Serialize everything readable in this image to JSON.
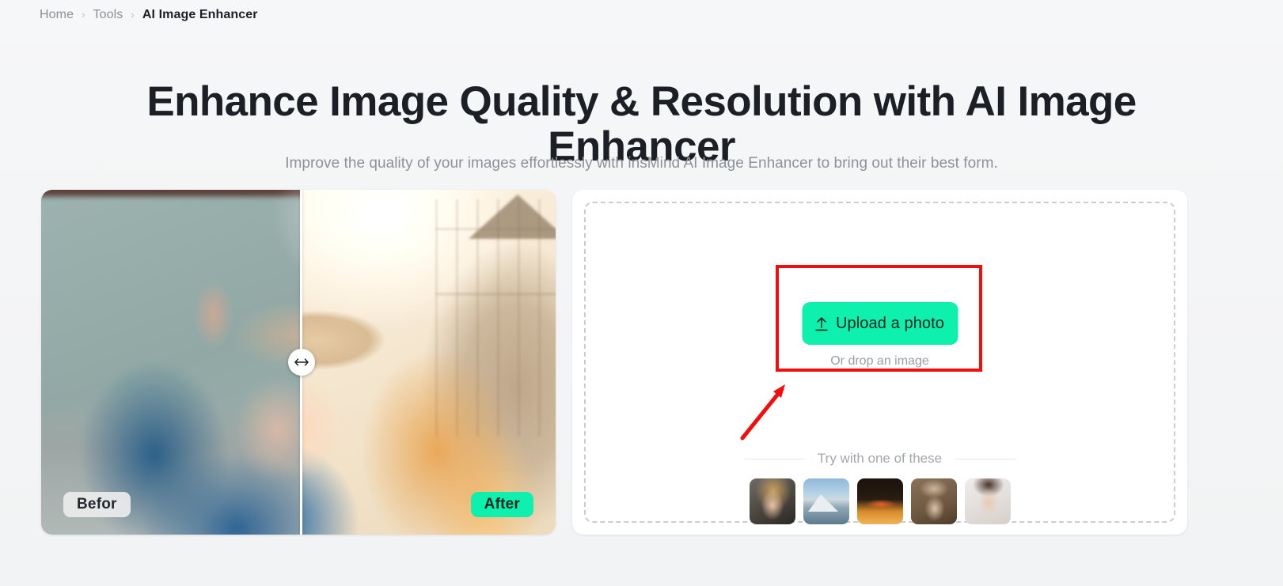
{
  "breadcrumb": {
    "items": [
      {
        "label": "Home",
        "current": false
      },
      {
        "label": "Tools",
        "current": false
      },
      {
        "label": "AI Image Enhancer",
        "current": true
      }
    ],
    "separator": "›"
  },
  "hero": {
    "title": "Enhance Image Quality & Resolution with AI Image Enhancer",
    "subtitle": "Improve the quality of your images effortlessly with insMind AI Image Enhancer to bring out their best form."
  },
  "preview": {
    "before_label": "Befor",
    "after_label": "After",
    "handle_icon": "left-right-arrow-icon",
    "divider_position_percent": 50
  },
  "upload": {
    "button_label": "Upload a photo",
    "button_icon": "upload-arrow-icon",
    "drop_hint": "Or drop an image",
    "try_label": "Try with one of these",
    "samples": [
      {
        "name": "blonde-woman-portrait"
      },
      {
        "name": "snowy-mountain-landscape"
      },
      {
        "name": "orange-speedboat"
      },
      {
        "name": "vintage-sepia-portrait"
      },
      {
        "name": "woman-with-sunglasses"
      }
    ]
  },
  "colors": {
    "accent_green": "#0ef0ae",
    "annotation_red": "#f40d0d",
    "page_background": "#f4f5f6",
    "card_background": "#ffffff",
    "dashed_border": "#c9ccd1",
    "title_text": "#1c2026",
    "muted_text": "#8d919a"
  },
  "annotations": {
    "highlight_box": "upload-photo-button",
    "arrow": "points-to-upload-button"
  }
}
